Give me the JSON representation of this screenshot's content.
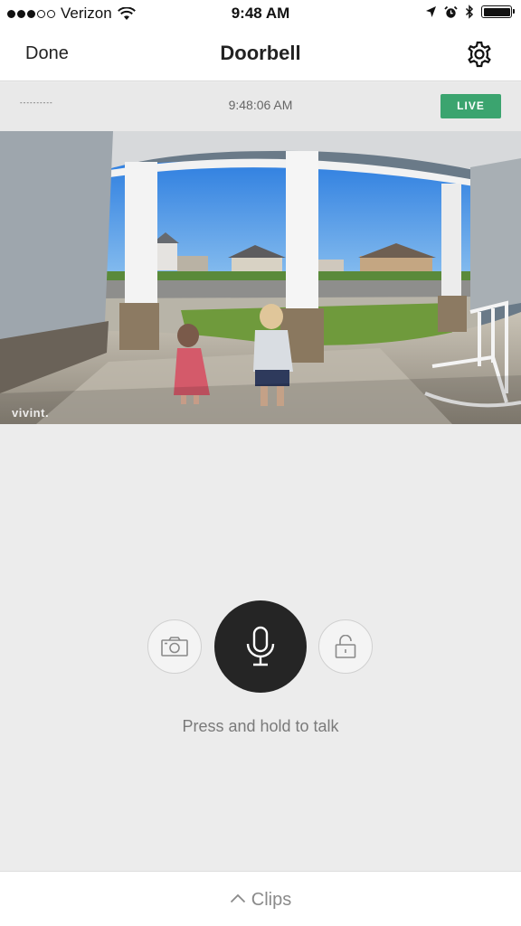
{
  "status_bar": {
    "carrier": "Verizon",
    "time": "9:48 AM"
  },
  "nav": {
    "done_label": "Done",
    "title": "Doorbell"
  },
  "camera": {
    "name": "----------",
    "timestamp": "9:48:06 AM",
    "live_label": "LIVE",
    "watermark": "vivint."
  },
  "controls": {
    "talk_hint": "Press and hold to talk"
  },
  "clips": {
    "label": "Clips"
  },
  "colors": {
    "live_green": "#3ba46f",
    "mic_button": "#252525"
  },
  "icons": [
    "wifi-icon",
    "location-arrow-icon",
    "alarm-icon",
    "bluetooth-icon",
    "battery-icon",
    "gear-icon",
    "camera-icon",
    "microphone-icon",
    "unlock-icon",
    "chevron-up-icon"
  ]
}
